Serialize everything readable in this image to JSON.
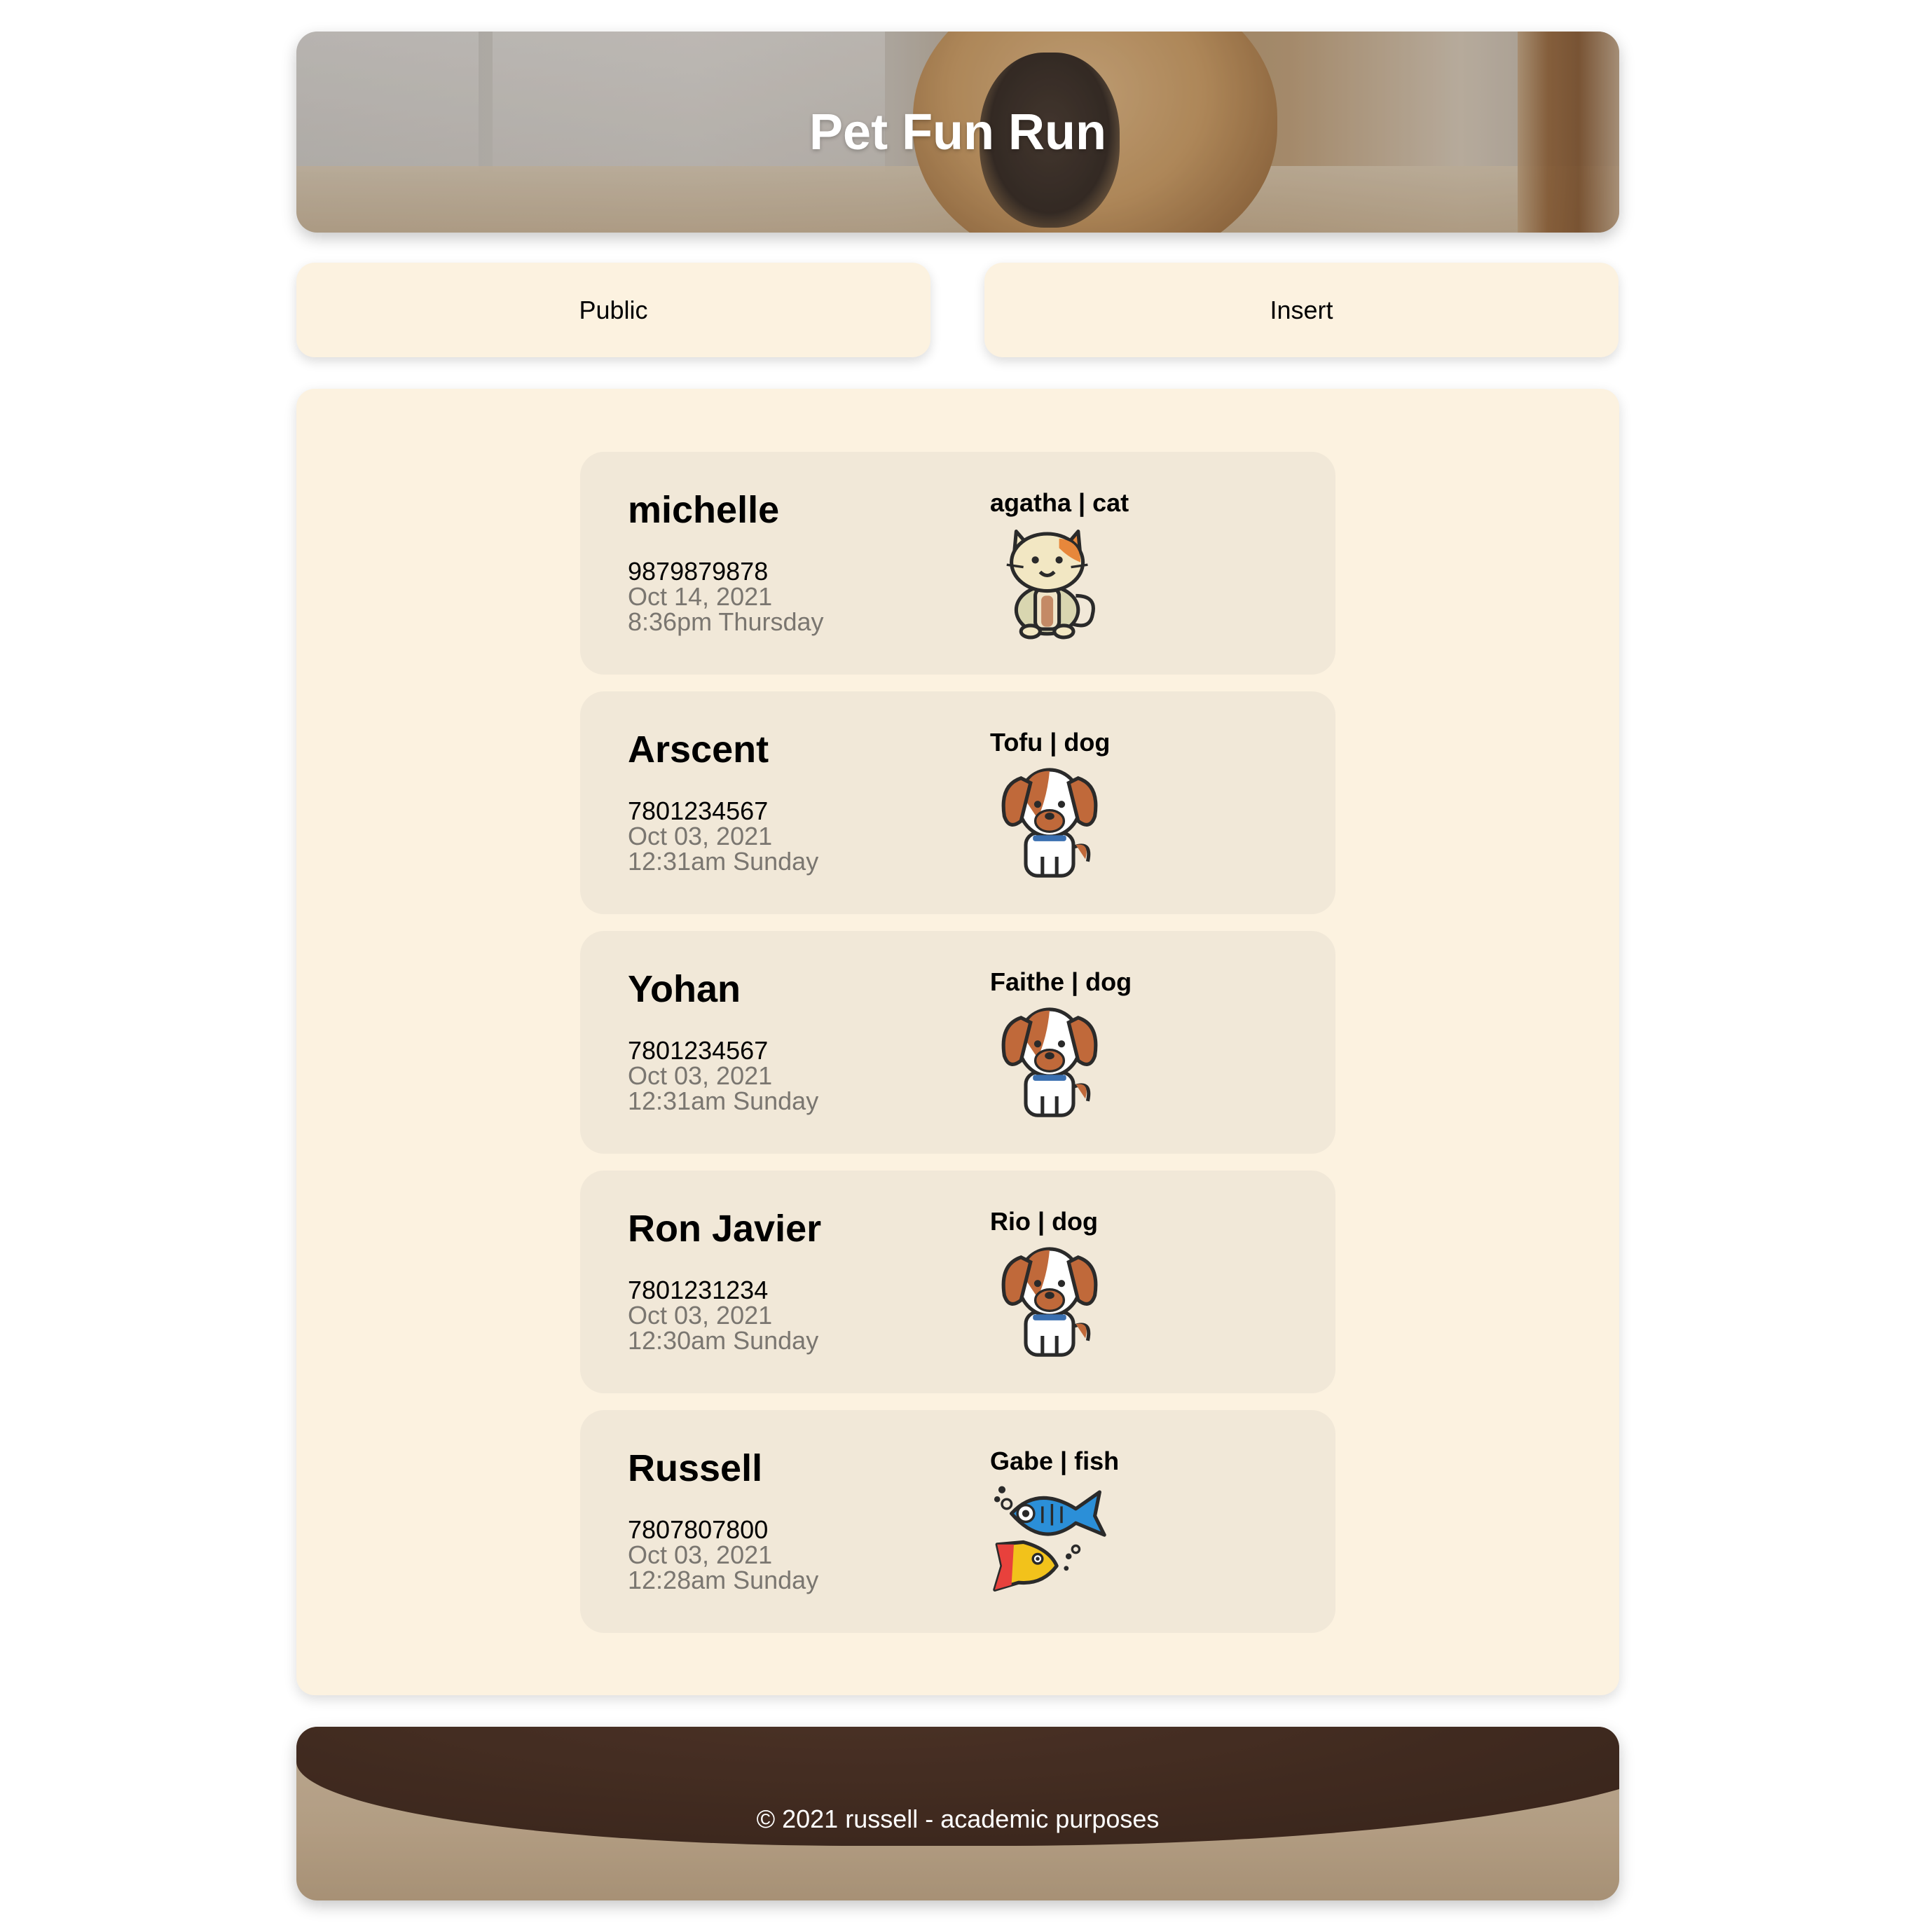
{
  "header": {
    "title": "Pet Fun Run"
  },
  "nav": {
    "public_label": "Public",
    "insert_label": "Insert"
  },
  "entries": [
    {
      "owner": "michelle",
      "phone": "9879879878",
      "date": "Oct 14, 2021",
      "time": "8:36pm Thursday",
      "pet": "agatha | cat",
      "icon": "cat-icon"
    },
    {
      "owner": "Arscent",
      "phone": "7801234567",
      "date": "Oct 03, 2021",
      "time": "12:31am Sunday",
      "pet": "Tofu | dog",
      "icon": "dog-icon"
    },
    {
      "owner": "Yohan",
      "phone": "7801234567",
      "date": "Oct 03, 2021",
      "time": "12:31am Sunday",
      "pet": "Faithe | dog",
      "icon": "dog-icon"
    },
    {
      "owner": "Ron Javier",
      "phone": "7801231234",
      "date": "Oct 03, 2021",
      "time": "12:30am Sunday",
      "pet": "Rio | dog",
      "icon": "dog-icon"
    },
    {
      "owner": "Russell",
      "phone": "7807807800",
      "date": "Oct 03, 2021",
      "time": "12:28am Sunday",
      "pet": "Gabe | fish",
      "icon": "fish-icon"
    }
  ],
  "footer": {
    "copyright": "© 2021 russell - academic purposes"
  },
  "colors": {
    "panel": "#fcf2e0",
    "card": "#f1e8d8",
    "muted_text": "#7a7670"
  }
}
